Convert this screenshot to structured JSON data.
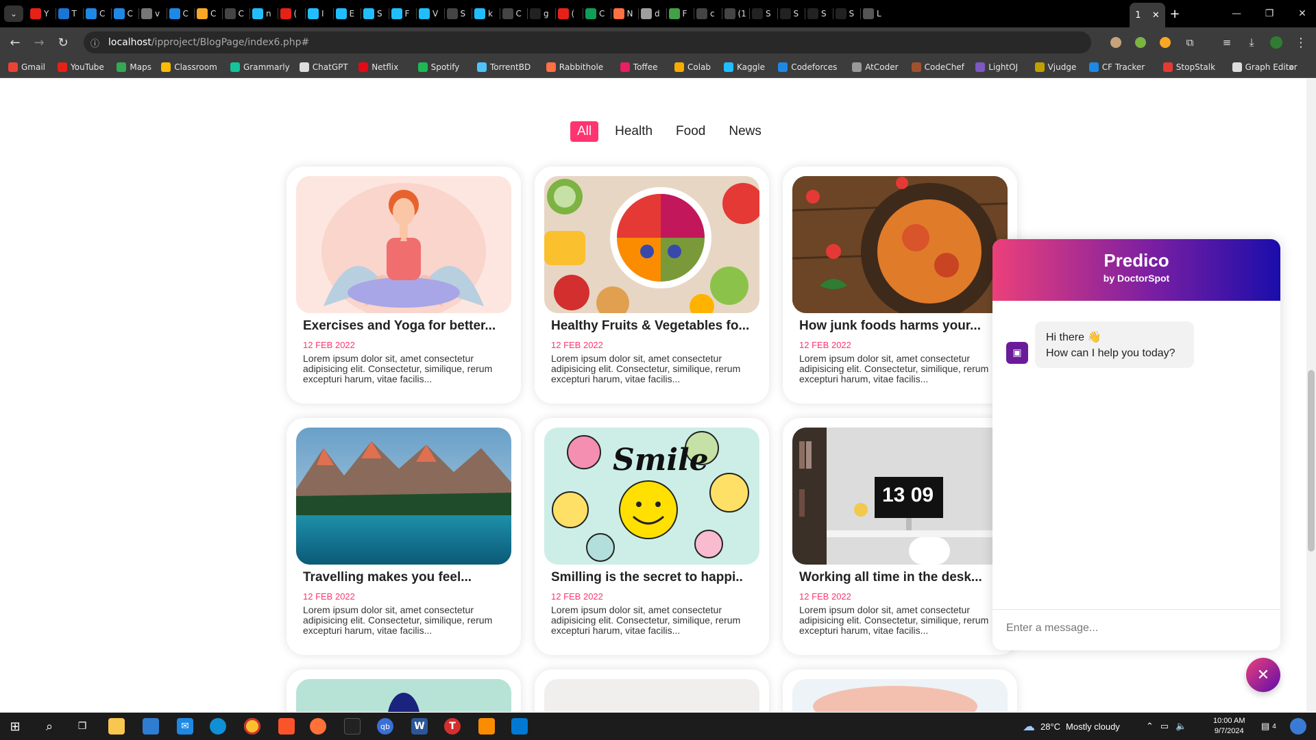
{
  "browser": {
    "tabs": [
      {
        "icon": "youtube-icon",
        "label": "Y",
        "color": "#e62117"
      },
      {
        "icon": "site-icon",
        "label": "T",
        "color": "#1976d2"
      },
      {
        "icon": "chrome-c-icon",
        "label": "C",
        "color": "#1e88e5"
      },
      {
        "icon": "chrome-c-icon",
        "label": "C",
        "color": "#1e88e5"
      },
      {
        "icon": "site-icon",
        "label": "v",
        "color": "#777"
      },
      {
        "icon": "chrome-c-icon",
        "label": "C",
        "color": "#1e88e5"
      },
      {
        "icon": "colab-icon",
        "label": "C",
        "color": "#f9a825"
      },
      {
        "icon": "chatgpt-icon",
        "label": "C",
        "color": "#444"
      },
      {
        "icon": "kaggle-icon",
        "label": "n",
        "color": "#20beff"
      },
      {
        "icon": "youtube-icon",
        "label": "(",
        "color": "#e62117"
      },
      {
        "icon": "kaggle-icon",
        "label": "I",
        "color": "#20beff"
      },
      {
        "icon": "kaggle-icon",
        "label": "E",
        "color": "#20beff"
      },
      {
        "icon": "kaggle-icon",
        "label": "S",
        "color": "#20beff"
      },
      {
        "icon": "kaggle-icon",
        "label": "F",
        "color": "#20beff"
      },
      {
        "icon": "kaggle-icon",
        "label": "V",
        "color": "#20beff"
      },
      {
        "icon": "chatgpt-icon",
        "label": "S",
        "color": "#444"
      },
      {
        "icon": "kaggle-icon",
        "label": "k",
        "color": "#20beff"
      },
      {
        "icon": "chatgpt-icon",
        "label": "C",
        "color": "#444"
      },
      {
        "icon": "github-icon",
        "label": "g",
        "color": "#fff"
      },
      {
        "icon": "youtube-icon",
        "label": "(",
        "color": "#e62117"
      },
      {
        "icon": "sheets-icon",
        "label": "C",
        "color": "#0f9d58"
      },
      {
        "icon": "site-icon",
        "label": "N",
        "color": "#ff7043"
      },
      {
        "icon": "site-icon",
        "label": "d",
        "color": "#9e9e9e"
      },
      {
        "icon": "site-icon",
        "label": "F",
        "color": "#43a047"
      },
      {
        "icon": "chatgpt-icon",
        "label": "c",
        "color": "#444"
      },
      {
        "icon": "audio-icon",
        "label": "(1",
        "color": "#444"
      },
      {
        "icon": "github-icon",
        "label": "S",
        "color": "#fff"
      },
      {
        "icon": "github-icon",
        "label": "S",
        "color": "#fff"
      },
      {
        "icon": "github-icon",
        "label": "S",
        "color": "#fff"
      },
      {
        "icon": "github-icon",
        "label": "S",
        "color": "#fff"
      },
      {
        "icon": "site-icon",
        "label": "L",
        "color": "#555"
      }
    ],
    "active_tab_label": "1",
    "url_host": "localhost",
    "url_path": "/ipproject/BlogPage/index6.php#",
    "bookmarks": [
      {
        "label": "Gmail",
        "color": "#ea4335"
      },
      {
        "label": "YouTube",
        "color": "#e62117"
      },
      {
        "label": "Maps",
        "color": "#34a853"
      },
      {
        "label": "Classroom",
        "color": "#fbbc04"
      },
      {
        "label": "Grammarly",
        "color": "#15c39a"
      },
      {
        "label": "ChatGPT",
        "color": "#ddd"
      },
      {
        "label": "Netflix",
        "color": "#e50914"
      },
      {
        "label": "Spotify",
        "color": "#1db954"
      },
      {
        "label": "TorrentBD",
        "color": "#4fc3f7"
      },
      {
        "label": "Rabbithole",
        "color": "#ff7043"
      },
      {
        "label": "Toffee",
        "color": "#e91e63"
      },
      {
        "label": "Colab",
        "color": "#f9ab00"
      },
      {
        "label": "Kaggle",
        "color": "#20beff"
      },
      {
        "label": "Codeforces",
        "color": "#1e88e5"
      },
      {
        "label": "AtCoder",
        "color": "#999"
      },
      {
        "label": "CodeChef",
        "color": "#a0522d"
      },
      {
        "label": "LightOJ",
        "color": "#7e57c2"
      },
      {
        "label": "Vjudge",
        "color": "#c0a000"
      },
      {
        "label": "CF Tracker",
        "color": "#1e88e5"
      },
      {
        "label": "StopStalk",
        "color": "#e53935"
      },
      {
        "label": "Graph Editor",
        "color": "#ddd"
      }
    ]
  },
  "filters": [
    "All",
    "Health",
    "Food",
    "News"
  ],
  "active_filter": "All",
  "cards": [
    {
      "title": "Exercises and Yoga for better...",
      "date": "12 FEB 2022",
      "desc": "Lorem ipsum dolor sit, amet consectetur adipisicing elit. Consectetur, similique, rerum excepturi harum, vitae facilis...",
      "image": "yoga"
    },
    {
      "title": "Healthy Fruits & Vegetables fo...",
      "date": "12 FEB 2022",
      "desc": "Lorem ipsum dolor sit, amet consectetur adipisicing elit. Consectetur, similique, rerum excepturi harum, vitae facilis...",
      "image": "fruits"
    },
    {
      "title": "How junk foods harms your...",
      "date": "12 FEB 2022",
      "desc": "Lorem ipsum dolor sit, amet consectetur adipisicing elit. Consectetur, similique, rerum excepturi harum, vitae facilis...",
      "image": "pasta"
    },
    {
      "title": "Travelling makes you feel...",
      "date": "12 FEB 2022",
      "desc": "Lorem ipsum dolor sit, amet consectetur adipisicing elit. Consectetur, similique, rerum excepturi harum, vitae facilis...",
      "image": "lake"
    },
    {
      "title": "Smilling is the secret to happi..",
      "date": "12 FEB 2022",
      "desc": "Lorem ipsum dolor sit, amet consectetur adipisicing elit. Consectetur, similique, rerum excepturi harum, vitae facilis...",
      "image": "smile"
    },
    {
      "title": "Working all time in the desk...",
      "date": "12 FEB 2022",
      "desc": "Lorem ipsum dolor sit, amet consectetur adipisicing elit. Consectetur, similique, rerum excepturi harum, vitae facilis...",
      "image": "desk"
    }
  ],
  "smile_text": "Smile",
  "clock_text": "13 09",
  "chatbot": {
    "title": "Predico",
    "subtitle": "by DoctorSpot",
    "greeting": "Hi there 👋",
    "question": "How can I help you today?",
    "input_placeholder": "Enter a message..."
  },
  "taskbar": {
    "weather_temp": "28°C",
    "weather_desc": "Mostly cloudy",
    "time": "10:00 AM",
    "date": "9/7/2024",
    "notifications": "4"
  },
  "colors": {
    "accent": "#ff3470",
    "chat_start": "#ec407a",
    "chat_end": "#1a0dab"
  }
}
